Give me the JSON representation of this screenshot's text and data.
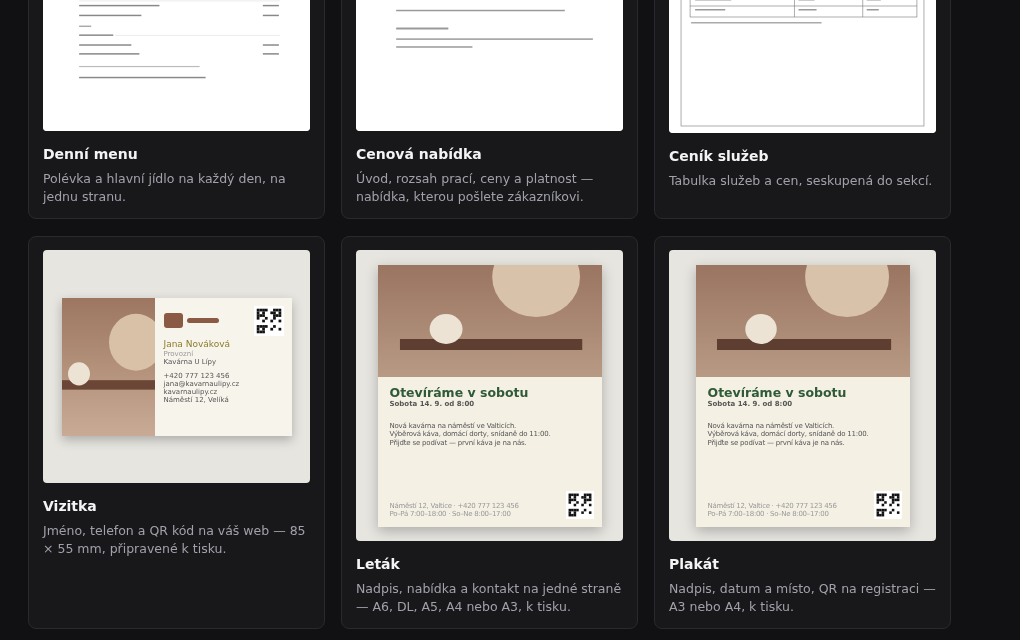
{
  "cards": [
    {
      "title": "Denní menu",
      "description": "Polévka a hlavní jídlo na každý den, na jednu stranu.",
      "thumbnail": {
        "kind": "menu"
      }
    },
    {
      "title": "Cenová nabídka",
      "description": "Úvod, rozsah prací, ceny a platnost — nabídka, kterou pošlete zákazníkovi.",
      "thumbnail": {
        "kind": "quote"
      }
    },
    {
      "title": "Ceník služeb",
      "description": "Tabulka služeb a cen, seskupená do sekcí.",
      "thumbnail": {
        "kind": "pricelist"
      }
    },
    {
      "title": "Vizitka",
      "description": "Jméno, telefon a QR kód na váš web — 85 × 55 mm, připravené k tisku.",
      "thumbnail": {
        "kind": "business-card",
        "name": "Jana Nováková",
        "role": "Provozní",
        "company": "Kavárna U Lípy",
        "contacts": [
          "+420 777 123 456",
          "jana@kavarnaulipy.cz",
          "kavarnaulipy.cz",
          "Náměstí 12, Velíká"
        ]
      }
    },
    {
      "title": "Leták",
      "description": "Nadpis, nabídka a kontakt na jedné straně — A6, DL, A5, A4 nebo A3, k tisku.",
      "thumbnail": {
        "kind": "flyer",
        "headline": "Otevíráme v sobotu",
        "date": "Sobota 14. 9. od 8:00",
        "body": [
          "Nová kavárna na náměstí ve Valticích.",
          "Výběrová káva, domácí dorty, snídaně do 11:00.",
          "Přijďte se podívat — první káva je na nás."
        ],
        "footer": [
          "Náměstí 12, Valtice · +420 777 123 456",
          "Po–Pá 7:00–18:00 · So–Ne 8:00–17:00"
        ]
      }
    },
    {
      "title": "Plakát",
      "description": "Nadpis, datum a místo, QR na registraci — A3 nebo A4, k tisku.",
      "thumbnail": {
        "kind": "flyer",
        "headline": "Otevíráme v sobotu",
        "date": "Sobota 14. 9. od 8:00",
        "body": [
          "Nová kavárna na náměstí ve Valticích.",
          "Výběrová káva, domácí dorty, snídaně do 11:00.",
          "Přijďte se podívat — první káva je na nás."
        ],
        "footer": [
          "Náměstí 12, Valtice · +420 777 123 456",
          "Po–Pá 7:00–18:00 · So–Ne 8:00–17:00"
        ]
      }
    }
  ]
}
